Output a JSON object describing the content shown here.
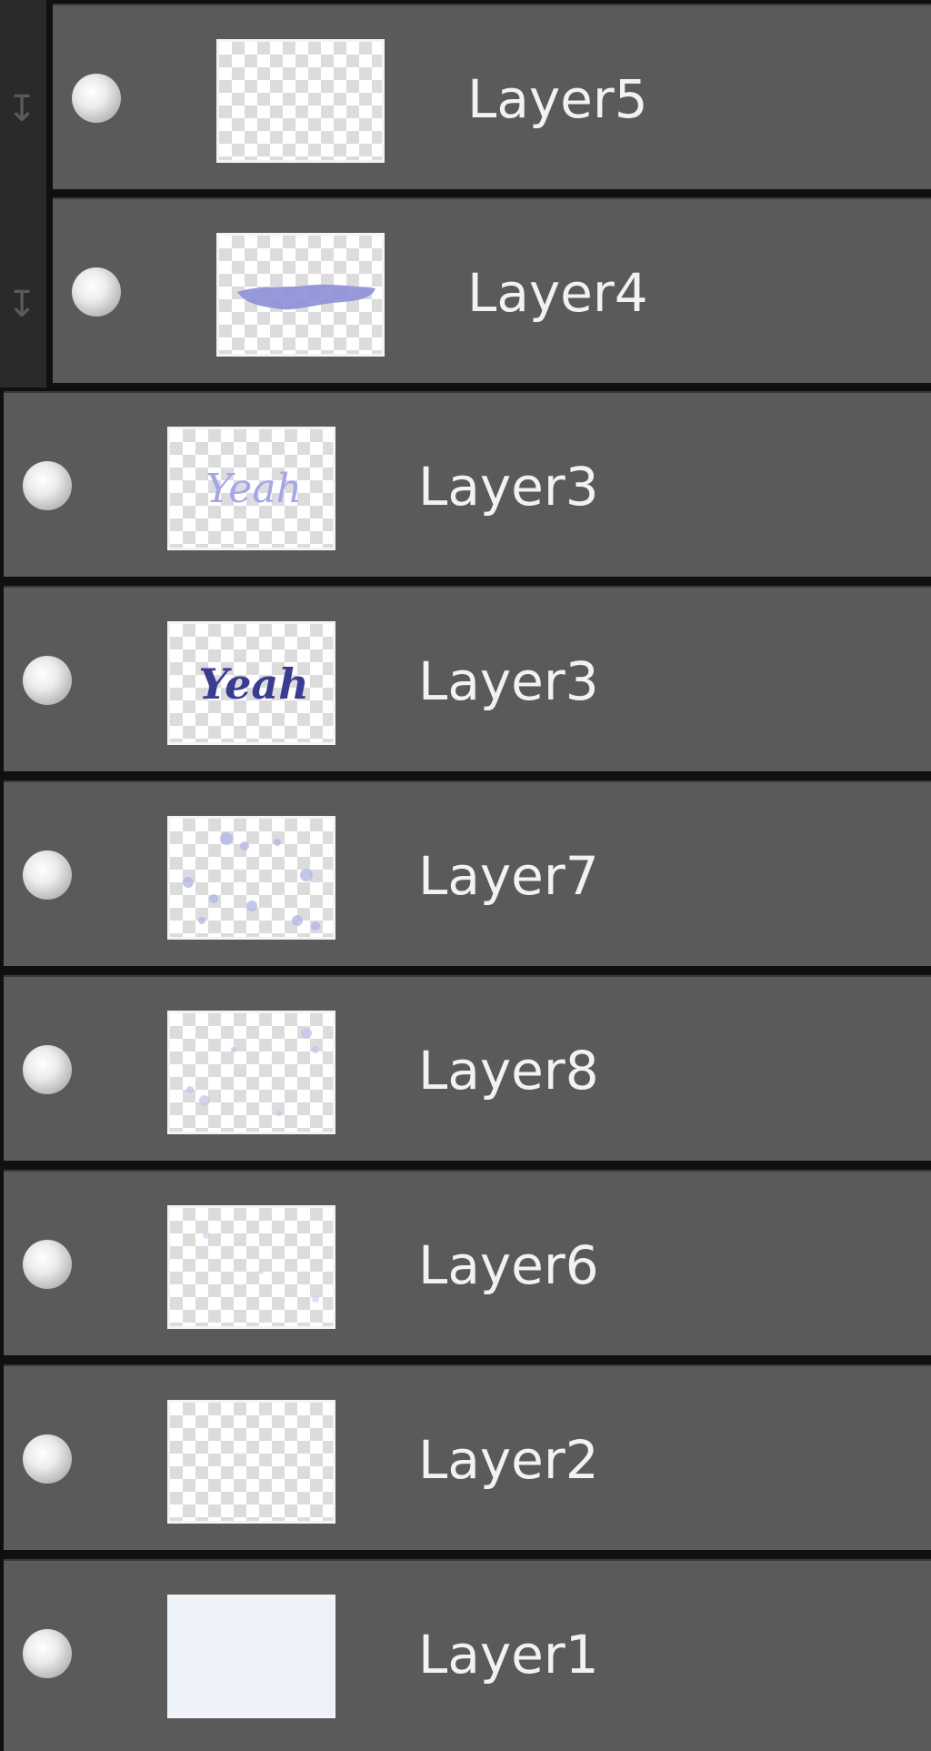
{
  "layers_panel": {
    "layers": [
      {
        "name": "Layer5",
        "thumbnail": "empty",
        "clipped": true
      },
      {
        "name": "Layer4",
        "thumbnail": "brush-stroke",
        "clipped": true
      },
      {
        "name": "Layer3",
        "thumbnail": "yeah-light",
        "clipped": false
      },
      {
        "name": "Layer3",
        "thumbnail": "yeah-dark",
        "clipped": false
      },
      {
        "name": "Layer7",
        "thumbnail": "scatter",
        "clipped": false
      },
      {
        "name": "Layer8",
        "thumbnail": "scatter-faint",
        "clipped": false
      },
      {
        "name": "Layer6",
        "thumbnail": "faint",
        "clipped": false
      },
      {
        "name": "Layer2",
        "thumbnail": "empty",
        "clipped": false
      },
      {
        "name": "Layer1",
        "thumbnail": "solid-fill",
        "clipped": false
      }
    ],
    "thumbnail_text": "Yeah",
    "colors": {
      "row_background": "#5a5a5a",
      "row_separator": "#101010",
      "label_color": "#f2f2f2",
      "accent_purple": "#8e90d8",
      "accent_dark_purple": "#3a3c92",
      "solid_fill": "#eef2fb"
    }
  }
}
